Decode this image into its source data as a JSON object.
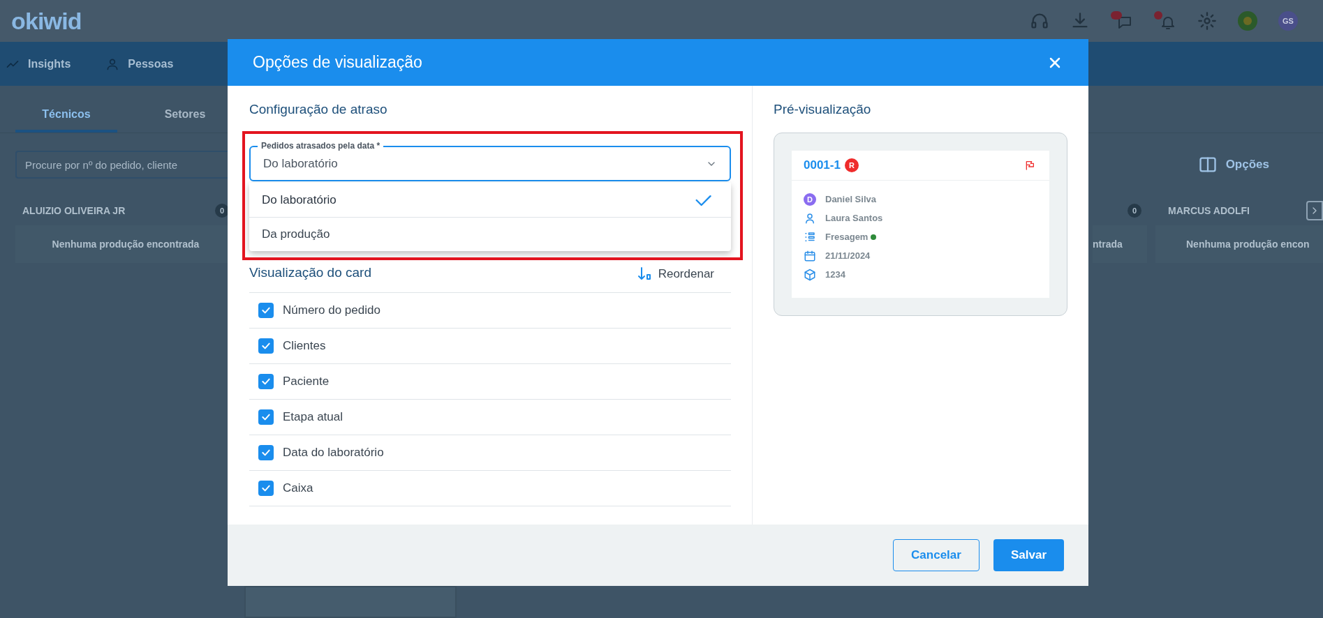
{
  "app": {
    "logo": "okiwid",
    "user_initials": "GS",
    "nav": [
      {
        "label": "Insights"
      },
      {
        "label": "Pessoas"
      }
    ],
    "tabs": [
      {
        "label": "Técnicos",
        "selected": true
      },
      {
        "label": "Setores",
        "selected": false
      }
    ],
    "search": {
      "placeholder": "Procure por nº do pedido, cliente"
    },
    "options_button": "Opções",
    "columns": [
      {
        "name": "ALUIZIO OLIVEIRA JR",
        "count": "0",
        "empty_text": "Nenhuma produção encontrada"
      },
      {
        "count": "0",
        "empty_text": "ntrada"
      },
      {
        "name": "MARCUS ADOLFI",
        "empty_text": "Nenhuma produção encon"
      }
    ]
  },
  "dialog": {
    "title": "Opções de visualização",
    "delay_section": {
      "title": "Configuração de atraso",
      "select": {
        "label": "Pedidos atrasados pela data *",
        "value": "Do laboratório",
        "expanded": true,
        "options": [
          {
            "label": "Do laboratório",
            "selected": true
          },
          {
            "label": "Da produção",
            "selected": false
          }
        ]
      }
    },
    "card_section": {
      "title": "Visualização do card",
      "reorder": "Reordenar",
      "fields": [
        {
          "label": "Número do pedido",
          "checked": true
        },
        {
          "label": "Clientes",
          "checked": true
        },
        {
          "label": "Paciente",
          "checked": true
        },
        {
          "label": "Etapa atual",
          "checked": true
        },
        {
          "label": "Data do laboratório",
          "checked": true
        },
        {
          "label": "Caixa",
          "checked": true
        }
      ]
    },
    "preview": {
      "title": "Pré-visualização",
      "order": "0001-1",
      "badge": "R",
      "rows": [
        {
          "kind": "avatar",
          "initial": "D",
          "text": "Daniel Silva"
        },
        {
          "kind": "person",
          "text": "Laura Santos"
        },
        {
          "kind": "step",
          "text": "Fresagem",
          "color": "#2e8b3a"
        },
        {
          "kind": "date",
          "text": "21/11/2024"
        },
        {
          "kind": "box",
          "text": "1234"
        }
      ]
    },
    "buttons": [
      {
        "label": "Cancelar",
        "kind": "secondary"
      },
      {
        "label": "Salvar",
        "kind": "primary"
      }
    ]
  }
}
